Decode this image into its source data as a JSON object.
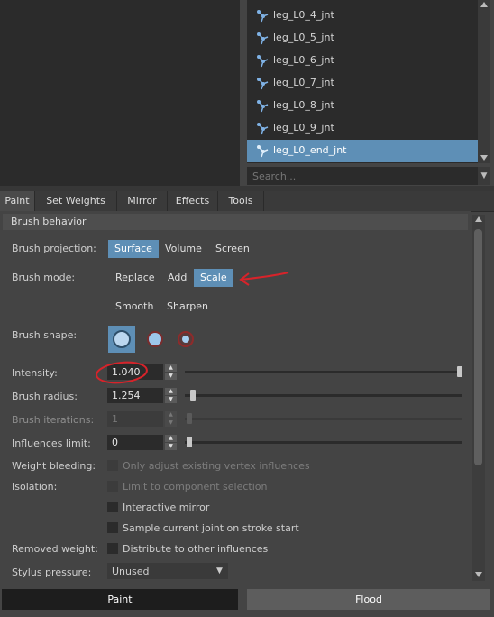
{
  "joints": [
    {
      "label": "leg_L0_4_jnt",
      "selected": false
    },
    {
      "label": "leg_L0_5_jnt",
      "selected": false
    },
    {
      "label": "leg_L0_6_jnt",
      "selected": false
    },
    {
      "label": "leg_L0_7_jnt",
      "selected": false
    },
    {
      "label": "leg_L0_8_jnt",
      "selected": false
    },
    {
      "label": "leg_L0_9_jnt",
      "selected": false
    },
    {
      "label": "leg_L0_end_jnt",
      "selected": true
    }
  ],
  "search": {
    "placeholder": "Search..."
  },
  "tabs": [
    "Paint",
    "Set Weights",
    "Mirror",
    "Effects",
    "Tools"
  ],
  "active_tab": "Paint",
  "section": {
    "title": "Brush behavior"
  },
  "brush_projection": {
    "label": "Brush projection:",
    "options": [
      "Surface",
      "Volume",
      "Screen"
    ],
    "selected": "Surface"
  },
  "brush_mode": {
    "label": "Brush mode:",
    "options": [
      "Replace",
      "Add",
      "Scale",
      "Smooth",
      "Sharpen"
    ],
    "selected": "Scale"
  },
  "brush_shape": {
    "label": "Brush shape:",
    "icons": [
      "solid-brush-icon",
      "soft-brush-icon",
      "gaussian-brush-icon"
    ],
    "selected": 0
  },
  "intensity": {
    "label": "Intensity:",
    "value": "1.040",
    "slider": 1.0
  },
  "brush_radius": {
    "label": "Brush radius:",
    "value": "1.254",
    "slider": 0.03
  },
  "brush_iterations": {
    "label": "Brush iterations:",
    "value": "1",
    "slider": 0.0
  },
  "influences_limit": {
    "label": "Influences limit:",
    "value": "0",
    "slider": 0.0
  },
  "weight_bleeding": {
    "label": "Weight bleeding:",
    "checkbox": "Only adjust existing vertex influences"
  },
  "isolation": {
    "label": "Isolation:",
    "checkboxes": [
      "Limit to component selection",
      "Interactive mirror",
      "Sample current joint on stroke start"
    ]
  },
  "removed_weight": {
    "label": "Removed weight:",
    "checkbox": "Distribute to other influences"
  },
  "stylus_pressure": {
    "label": "Stylus pressure:",
    "value": "Unused"
  },
  "bottom": {
    "paint": "Paint",
    "flood": "Flood"
  },
  "colors": {
    "accent": "#5e8fb6",
    "annotation": "#d8232a"
  }
}
